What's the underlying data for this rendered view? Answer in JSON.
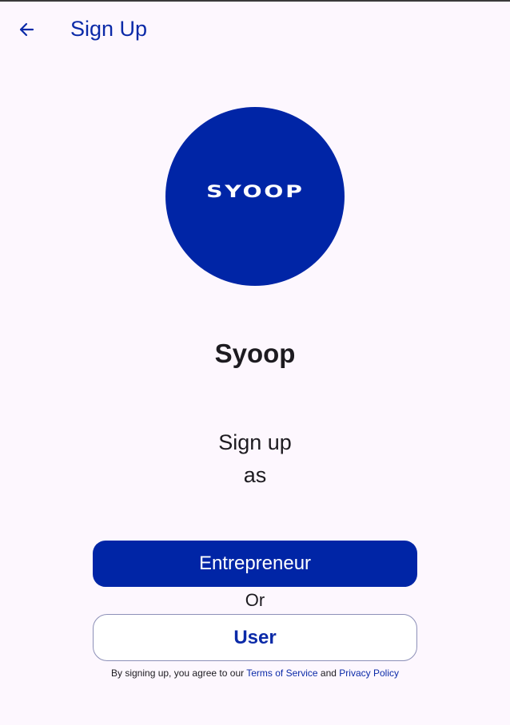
{
  "app_bar": {
    "back_icon": "arrow-left-icon",
    "title": "Sign Up"
  },
  "logo": {
    "text": "SYOOP",
    "color": "#0025a6"
  },
  "app_name": "Syoop",
  "prompt": {
    "line1": "Sign up",
    "line2": "as"
  },
  "buttons": {
    "entrepreneur": "Entrepreneur",
    "or": "Or",
    "user": "User"
  },
  "terms": {
    "prefix": "By signing up, you agree to our ",
    "tos": "Terms of Service",
    "and": " and ",
    "privacy": "Privacy Policy"
  },
  "colors": {
    "primary": "#0025a6",
    "background": "#fdf7fe"
  }
}
